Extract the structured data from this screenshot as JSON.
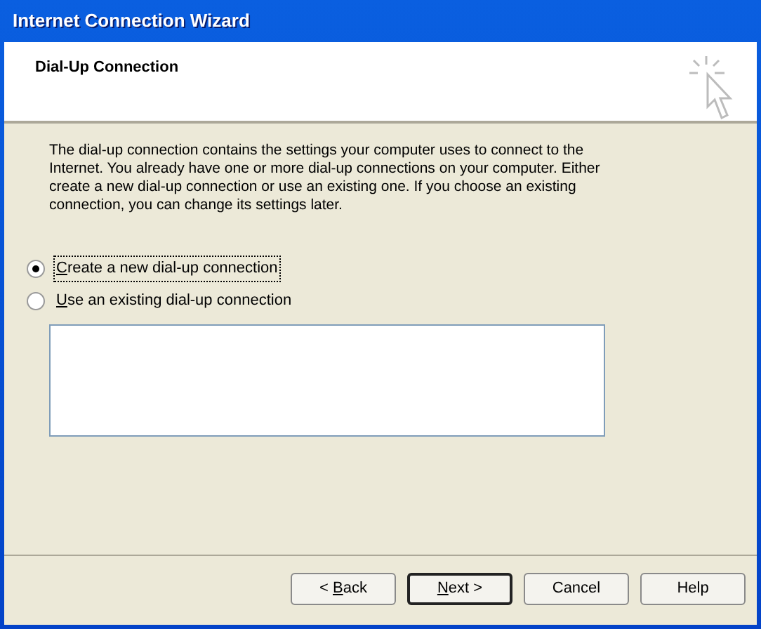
{
  "window": {
    "title": "Internet Connection Wizard"
  },
  "header": {
    "title": "Dial-Up Connection"
  },
  "description": "The dial-up connection contains the settings your computer uses to connect to the Internet. You already have one or more dial-up connections on your computer. Either create a new dial-up connection or use an existing one. If you choose an existing connection, you can change its settings later.",
  "options": [
    {
      "access_key": "C",
      "after": "reate a new dial-up connection",
      "selected": true,
      "focused": true
    },
    {
      "access_key": "U",
      "after": "se an existing dial-up connection",
      "selected": false,
      "focused": false
    }
  ],
  "buttons": [
    {
      "before": "< ",
      "access_key": "B",
      "after": "ack",
      "default": false
    },
    {
      "access_key": "N",
      "after": "ext >",
      "default": true
    },
    {
      "before": "Cancel",
      "default": false
    },
    {
      "before": "Help",
      "default": false
    }
  ]
}
